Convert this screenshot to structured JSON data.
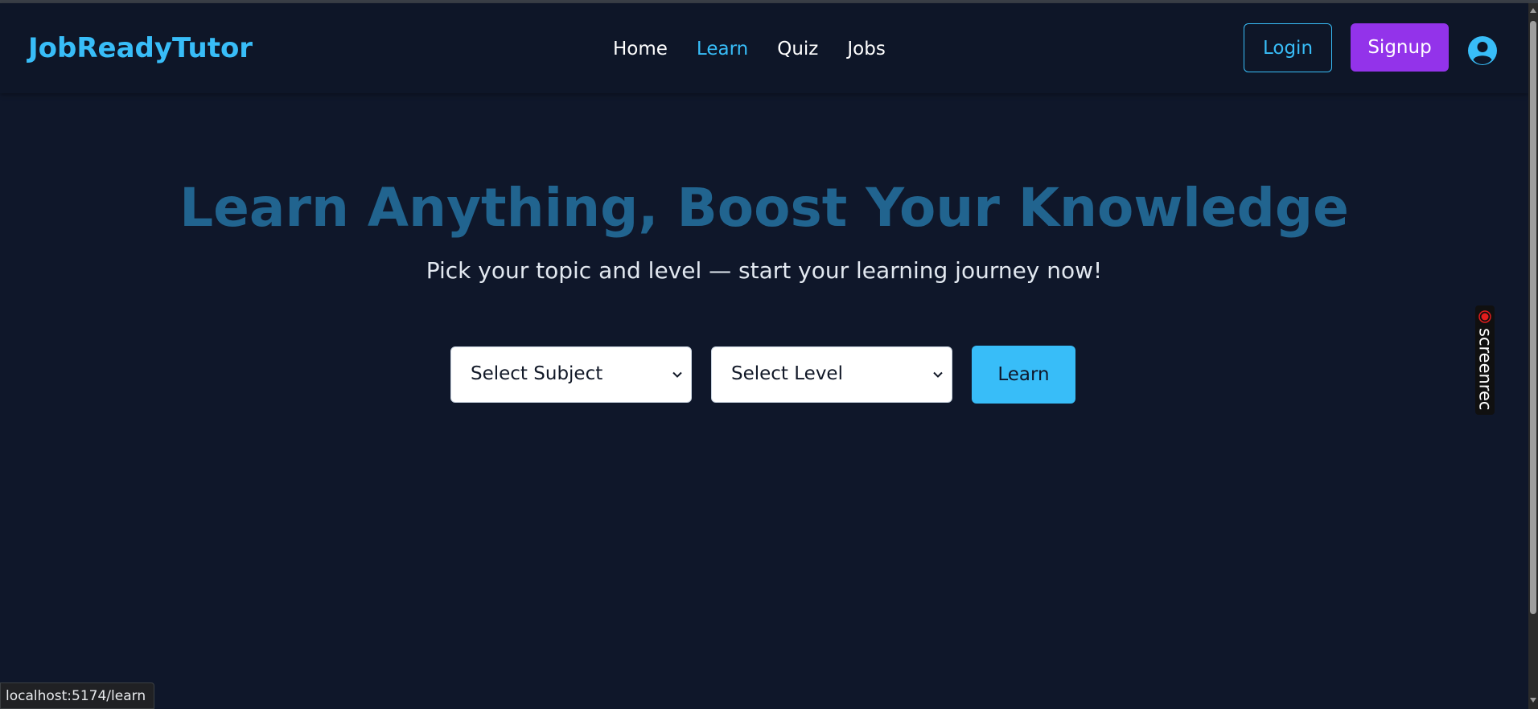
{
  "colors": {
    "background": "#0f172a",
    "accent": "#38bdf8",
    "signup": "#9333ea",
    "hero_title": "#21648f",
    "text": "#ffffff"
  },
  "header": {
    "logo": "JobReadyTutor",
    "nav": [
      {
        "label": "Home",
        "active": false
      },
      {
        "label": "Learn",
        "active": true
      },
      {
        "label": "Quiz",
        "active": false
      },
      {
        "label": "Jobs",
        "active": false
      }
    ],
    "login_label": "Login",
    "signup_label": "Signup",
    "profile_icon": "user-circle-icon"
  },
  "hero": {
    "title": "Learn Anything, Boost Your Knowledge",
    "subtitle": "Pick your topic and level — start your learning journey now!"
  },
  "form": {
    "subject_select": {
      "value": "Select Subject",
      "icon": "chevron-down-icon"
    },
    "level_select": {
      "value": "Select Level",
      "icon": "chevron-down-icon"
    },
    "learn_button": "Learn"
  },
  "overlay": {
    "recorder_label": "screenrec"
  },
  "status_bar": {
    "url": "localhost:5174/learn"
  }
}
